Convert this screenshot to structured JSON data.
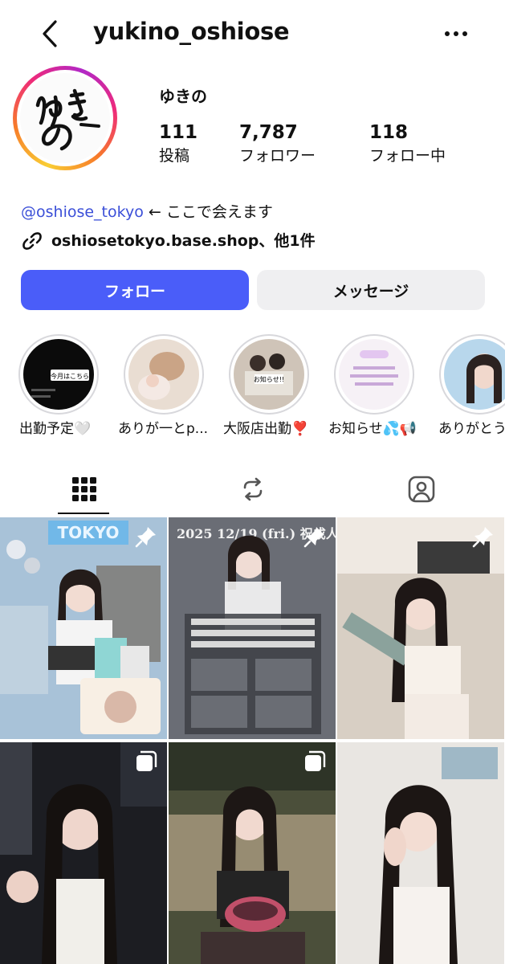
{
  "header": {
    "username": "yukino_oshiose",
    "back_icon": "chevron-left-icon",
    "more_icon": "more-horizontal-icon"
  },
  "profile": {
    "avatar_text": "ゆきの",
    "display_name": "ゆきの",
    "stats": [
      {
        "value": "111",
        "label": "投稿"
      },
      {
        "value": "7,787",
        "label": "フォロワー"
      },
      {
        "value": "118",
        "label": "フォロー中"
      }
    ],
    "bio_mention": "@oshiose_tokyo",
    "bio_text": " ← ここで会えます",
    "link_text": "oshiosetokyo.base.shop、他1件"
  },
  "buttons": {
    "follow": "フォロー",
    "message": "メッセージ"
  },
  "highlights": [
    {
      "label": "出勤予定🤍",
      "cover_text": "今月はこちら"
    },
    {
      "label": "ありが一とp..."
    },
    {
      "label": "大阪店出勤❣️",
      "cover_text": "お知らせ!!"
    },
    {
      "label": "お知らせ💦📢",
      "cover_text": "12月19日 空けておいてください!! 詳細お楽しみに"
    },
    {
      "label": "ありがとう"
    }
  ],
  "tabs": [
    {
      "name": "grid",
      "icon": "grid-icon",
      "active": true
    },
    {
      "name": "reels",
      "icon": "repost-icon"
    },
    {
      "name": "tagged",
      "icon": "tagged-person-icon"
    }
  ],
  "posts": [
    {
      "badge": "pin-icon",
      "text": "TOKYO"
    },
    {
      "badge": "pin-icon",
      "text": "2025 12/19 (fri.) 祝成人~"
    },
    {
      "badge": "pin-icon"
    },
    {
      "badge": "carousel-icon"
    },
    {
      "badge": "carousel-icon"
    },
    {}
  ],
  "colors": {
    "follow_button": "#4a5df9",
    "message_button": "#efeff1",
    "mention_link": "#3b4fd8"
  }
}
